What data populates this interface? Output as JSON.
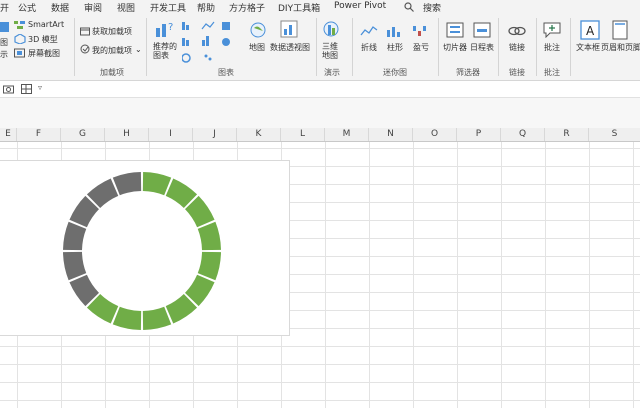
{
  "menu": {
    "tabs": [
      "开",
      "公式",
      "数据",
      "审阅",
      "视图",
      "开发工具",
      "帮助",
      "方方格子",
      "DIY工具箱",
      "Power Pivot",
      "搜索"
    ]
  },
  "ribbon": {
    "illustrations": {
      "smartart_label": "SmartArt",
      "model3d_label": "3D 模型",
      "screenshot_label": "屏幕截图",
      "partial_top": "图",
      "partial_bottom": "示"
    },
    "addins": {
      "get_label": "获取加载项",
      "my_label": "我的加载项",
      "group": "加载项"
    },
    "charts": {
      "recommended_label": "推荐的图表",
      "map_label": "地图",
      "pivotchart_label": "数据透视图",
      "group": "图表"
    },
    "tours": {
      "map3d_label": "三维地图",
      "group": "演示"
    },
    "sparklines": {
      "line_label": "折线",
      "column_label": "柱形",
      "winloss_label": "盈亏",
      "group": "迷你图"
    },
    "filters": {
      "slicer_label": "切片器",
      "timeline_label": "日程表",
      "group": "筛选器"
    },
    "links": {
      "link_label": "链接",
      "group": "链接"
    },
    "comments": {
      "comment_label": "批注",
      "group": "批注"
    },
    "text": {
      "textbox_label": "文本框",
      "headerfooter_label": "页眉和页脚"
    }
  },
  "sheet": {
    "columns": [
      "E",
      "F",
      "G",
      "H",
      "I",
      "J",
      "K",
      "L",
      "M",
      "N",
      "O",
      "P",
      "Q",
      "R",
      "S"
    ]
  },
  "colors": {
    "green": "#70ad47",
    "gray": "#6e6e6e",
    "accent": "#217346"
  },
  "chart_data": {
    "type": "pie",
    "style": "doughnut",
    "segments": 16,
    "series": [
      {
        "name": "",
        "values": [
          10,
          6
        ],
        "colors": [
          "#70ad47",
          "#6e6e6e"
        ]
      }
    ],
    "title": "",
    "legend": "none"
  }
}
